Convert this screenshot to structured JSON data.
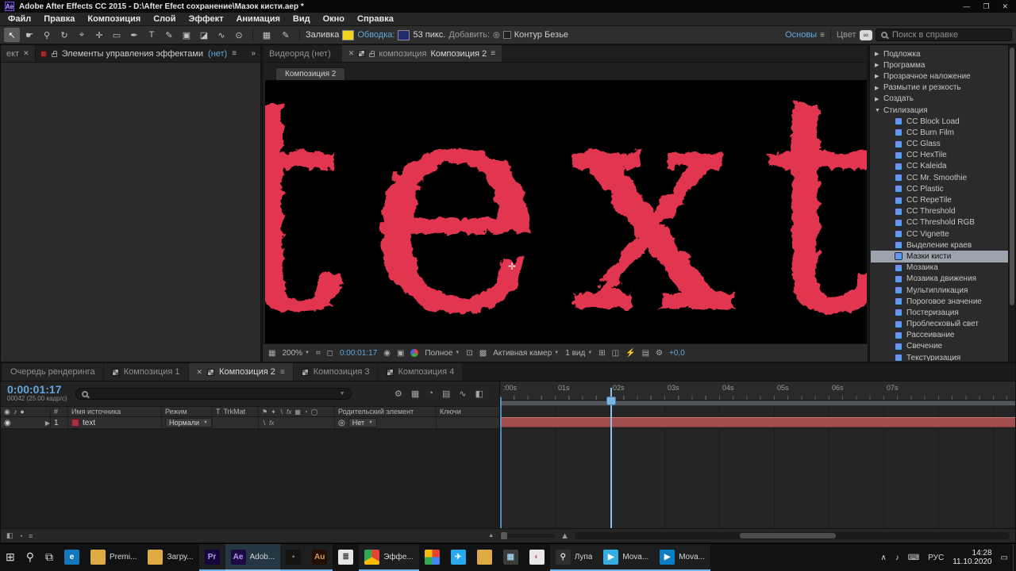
{
  "titlebar": {
    "app_badge": "Ae",
    "title": "Adobe After Effects CC 2015 - D:\\After Efect сохранение\\Мазок кисти.aep *",
    "minimize": "—",
    "maximize": "❐",
    "close": "✕"
  },
  "menubar": {
    "items": [
      "Файл",
      "Правка",
      "Композиция",
      "Слой",
      "Эффект",
      "Анимация",
      "Вид",
      "Окно",
      "Справка"
    ]
  },
  "toolbar": {
    "tools": [
      {
        "name": "selection-tool",
        "glyph": "↖",
        "active": true
      },
      {
        "name": "hand-tool",
        "glyph": "☛"
      },
      {
        "name": "zoom-tool",
        "glyph": "⚲"
      },
      {
        "name": "rotation-tool",
        "glyph": "↻"
      },
      {
        "name": "camera-tool",
        "glyph": "⌖"
      },
      {
        "name": "pan-behind-tool",
        "glyph": "✛"
      },
      {
        "name": "shape-tool",
        "glyph": "▭"
      },
      {
        "name": "pen-tool",
        "glyph": "✒"
      },
      {
        "name": "type-tool",
        "glyph": "T"
      },
      {
        "name": "brush-tool",
        "glyph": "✎"
      },
      {
        "name": "clone-stamp-tool",
        "glyph": "▣"
      },
      {
        "name": "eraser-tool",
        "glyph": "◪"
      },
      {
        "name": "roto-brush-tool",
        "glyph": "∿"
      },
      {
        "name": "puppet-pin-tool",
        "glyph": "⊙"
      }
    ],
    "fill_label": "Заливка",
    "fill_style": "background:#f0d41c",
    "stroke_label": "Обводка:",
    "stroke_style": "background:#232c6e",
    "stroke_width": "53 пикс.",
    "add_label": "Добавить:",
    "bezier_label": "Контур Безье",
    "workspace_active": "Основы",
    "workspace_next": "Цвет",
    "search_placeholder": "Поиск в справке"
  },
  "left_panel": {
    "partial_tab": "ект",
    "title": "Элементы управления эффектами",
    "title_suffix": "(нет)"
  },
  "viewer": {
    "tab_footage": "Видеоряд (нет)",
    "tab_comp_prefix": "композиция",
    "tab_comp_name": "Композиция 2",
    "breadcrumb": "Композиция 2",
    "canvas_text": "text",
    "text_color": "#e23650",
    "zoom": "200%",
    "timecode": "0:00:01:17",
    "resolution": "Полное",
    "camera": "Активная камер",
    "views": "1 вид",
    "exposure": "+0,0"
  },
  "effects_panel": {
    "rows": [
      {
        "type": "group",
        "label": "Подложка"
      },
      {
        "type": "group",
        "label": "Программа"
      },
      {
        "type": "group",
        "label": "Прозрачное наложение"
      },
      {
        "type": "group",
        "label": "Размытие и резкость"
      },
      {
        "type": "group",
        "label": "Создать"
      },
      {
        "type": "group",
        "label": "Стилизация",
        "expanded": true
      },
      {
        "type": "item",
        "label": "CC Block Load"
      },
      {
        "type": "item",
        "label": "CC Burn Film"
      },
      {
        "type": "item",
        "label": "CC Glass"
      },
      {
        "type": "item",
        "label": "CC HexTile"
      },
      {
        "type": "item",
        "label": "CC Kaleida"
      },
      {
        "type": "item",
        "label": "CC Mr. Smoothie"
      },
      {
        "type": "item",
        "label": "CC Plastic"
      },
      {
        "type": "item",
        "label": "CC RepeTile"
      },
      {
        "type": "item",
        "label": "CC Threshold"
      },
      {
        "type": "item",
        "label": "CC Threshold RGB"
      },
      {
        "type": "item",
        "label": "CC Vignette"
      },
      {
        "type": "item",
        "label": "Выделение краев"
      },
      {
        "type": "item",
        "label": "Мазки кисти",
        "selected": true
      },
      {
        "type": "item",
        "label": "Мозаика"
      },
      {
        "type": "item",
        "label": "Мозаика движения"
      },
      {
        "type": "item",
        "label": "Мультипликация"
      },
      {
        "type": "item",
        "label": "Пороговое значение"
      },
      {
        "type": "item",
        "label": "Постеризация"
      },
      {
        "type": "item",
        "label": "Проблесковый свет"
      },
      {
        "type": "item",
        "label": "Рассеивание"
      },
      {
        "type": "item",
        "label": "Свечение"
      },
      {
        "type": "item",
        "label": "Текстуризация"
      }
    ]
  },
  "timeline": {
    "tabs": [
      {
        "label": "Очередь рендеринга"
      },
      {
        "label": "Композиция 1",
        "comp": true
      },
      {
        "label": "Композиция 2",
        "comp": true,
        "active": true
      },
      {
        "label": "Композиция 3",
        "comp": true
      },
      {
        "label": "Композиция 4",
        "comp": true
      }
    ],
    "timecode": "0:00:01:17",
    "frame_info": "00042 (25.00 кадр/с)",
    "columns": {
      "index": "#",
      "source": "Имя источника",
      "mode": "Режим",
      "t": "T",
      "trkmat": "TrkMat",
      "parent": "Родительский элемент",
      "keys": "Ключи"
    },
    "layer": {
      "index": "1",
      "name": "text",
      "mode": "Нормали",
      "parent": "Нет"
    },
    "ruler_ticks": [
      ":00s",
      "01s",
      "02s",
      "03s",
      "04s",
      "05s",
      "06s",
      "07s"
    ]
  },
  "taskbar": {
    "items": [
      {
        "name": "start-button",
        "glyph": "⊞"
      },
      {
        "name": "search-button",
        "glyph": "⚲"
      },
      {
        "name": "task-view-button",
        "glyph": "⧉"
      },
      {
        "name": "edge-browser",
        "glyph": "e",
        "bg": "#1277bd",
        "fg": "#ffffff"
      },
      {
        "name": "folder-premiere",
        "glyph": "▬",
        "bg": "#dfa944",
        "fg": "#dfa944",
        "label": "Premi..."
      },
      {
        "name": "folder-downloads",
        "glyph": "▬",
        "bg": "#dfa944",
        "fg": "#dfa944",
        "label": "Загру..."
      },
      {
        "name": "premiere-pro",
        "glyph": "Pr",
        "bg": "#15053a",
        "fg": "#b79df2",
        "open": true
      },
      {
        "name": "after-effects",
        "glyph": "Ae",
        "bg": "#1d0a42",
        "fg": "#b19cf4",
        "label": "Adob...",
        "active": true
      },
      {
        "name": "dark-app",
        "glyph": "▪",
        "bg": "#141414",
        "fg": "#7a7a7a",
        "open": true
      },
      {
        "name": "audition",
        "glyph": "Au",
        "bg": "#231005",
        "fg": "#d49b5c",
        "open": true
      },
      {
        "name": "white-app",
        "glyph": "≣",
        "bg": "#e6e6e6",
        "fg": "#444444"
      },
      {
        "name": "chrome",
        "glyph": "",
        "bg": "conic-gradient(#ea4335 0 120deg,#fbbc05 0 240deg,#34a853 0)",
        "label": "Эффе...",
        "open": true
      },
      {
        "name": "pinwheel-app",
        "glyph": "",
        "bg": "conic-gradient(#e84335 0 90deg,#4285f4 0 180deg,#34a853 0 270deg,#fbbc05 0)"
      },
      {
        "name": "telegram",
        "glyph": "✈",
        "bg": "#29a9eb",
        "fg": "#ffffff"
      },
      {
        "name": "folder-generic",
        "glyph": "▬",
        "bg": "#dfa944",
        "fg": "#dfa944"
      },
      {
        "name": "calculator",
        "glyph": "▦",
        "bg": "#3b3b3b",
        "fg": "#9ccbe8"
      },
      {
        "name": "paint-app",
        "glyph": "◐",
        "bg": "#e8e8e8",
        "fg": "#d4586c"
      },
      {
        "name": "magnifier-app",
        "glyph": "⚲",
        "bg": "#2f2f2f",
        "fg": "#dddddd",
        "label": "Лупа",
        "open": true
      },
      {
        "name": "movavi-1",
        "glyph": "▶",
        "bg": "#35aee2",
        "fg": "#ffffff",
        "label": "Mova...",
        "open": true
      },
      {
        "name": "movavi-2",
        "glyph": "▶",
        "bg": "#0b7fc4",
        "fg": "#ffffff",
        "label": "Mova...",
        "open": true
      }
    ],
    "tray": [
      {
        "name": "tray-expand-icon",
        "glyph": "∧"
      },
      {
        "name": "volume-icon",
        "glyph": "♪"
      },
      {
        "name": "keyboard-icon",
        "glyph": "⌨"
      },
      {
        "name": "language-indicator",
        "glyph": "РУС"
      }
    ],
    "time": "14:28",
    "date": "11.10.2020",
    "action_center": "▭"
  }
}
